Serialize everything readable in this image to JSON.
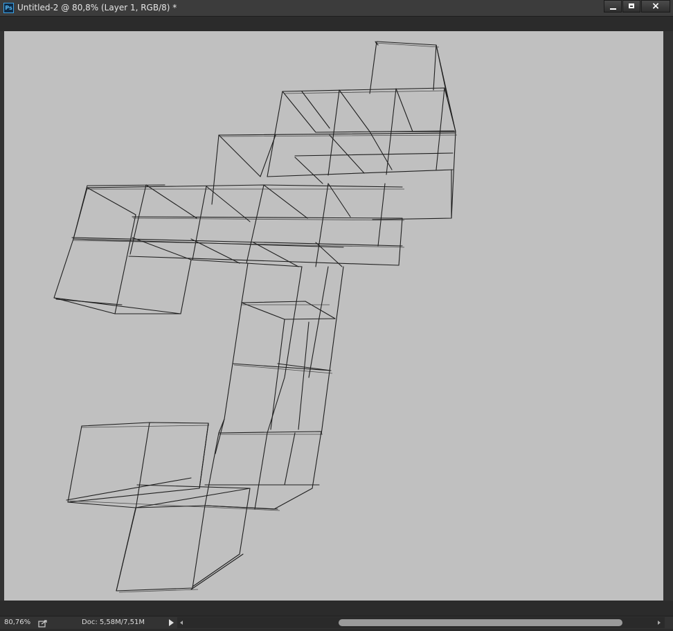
{
  "window": {
    "app_badge": "Ps",
    "title": "Untitled-2 @ 80,8% (Layer 1, RGB/8) *",
    "controls": {
      "minimize_icon": "minimize-icon",
      "maximize_icon": "maximize-icon",
      "close_icon": "close-icon",
      "close_glyph": "×"
    }
  },
  "canvas": {
    "background": "#c0c0c0",
    "stroke_color": "#1e1e1e",
    "content": "hand-drawn wireframe cube sketch"
  },
  "status": {
    "zoom": "80,76%",
    "doc": "Doc: 5,58M/7,51M"
  },
  "colors": {
    "chrome": "#333333",
    "titlebar": "#3c3c3c",
    "ps_blue": "#3ba5ea"
  }
}
